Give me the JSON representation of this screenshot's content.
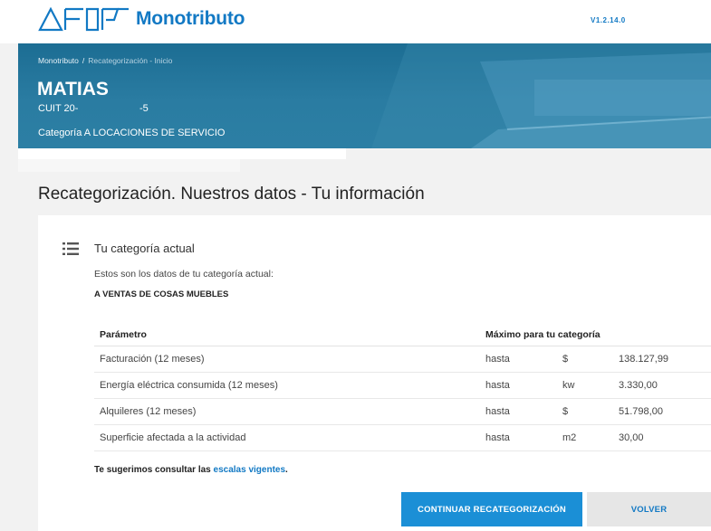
{
  "header": {
    "logo_text": "Monotributo",
    "logo_mark_label": "AFIP",
    "version": "V1.2.14.0"
  },
  "breadcrumb": {
    "items": [
      "Monotributo",
      "Recategorización - Inicio"
    ],
    "separator": "/"
  },
  "user": {
    "name": "MATIAS",
    "cuit_prefix": "CUIT 20-",
    "cuit_suffix": "-5",
    "categoria": "Categoría A LOCACIONES DE SERVICIO"
  },
  "page": {
    "title": "Recategorización. Nuestros datos - Tu información"
  },
  "section": {
    "icon": "list-icon",
    "title": "Tu categoría actual",
    "description": "Estos son los datos de tu categoría actual:",
    "current_category": "A VENTAS DE COSAS MUEBLES"
  },
  "table": {
    "headers": [
      "Parámetro",
      "Máximo para tu categoría"
    ],
    "rows": [
      {
        "param": "Facturación (12 meses)",
        "qualifier": "hasta",
        "unit": "$",
        "value": "138.127,99"
      },
      {
        "param": "Energía eléctrica consumida (12 meses)",
        "qualifier": "hasta",
        "unit": "kw",
        "value": "3.330,00"
      },
      {
        "param": "Alquileres (12 meses)",
        "qualifier": "hasta",
        "unit": "$",
        "value": "51.798,00"
      },
      {
        "param": "Superficie afectada a la actividad",
        "qualifier": "hasta",
        "unit": "m2",
        "value": "30,00"
      }
    ]
  },
  "suggestion": {
    "prefix": "Te sugerimos consultar las ",
    "link": "escalas vigentes",
    "suffix": "."
  },
  "buttons": {
    "continue": "CONTINUAR RECATEGORIZACIÓN",
    "back": "VOLVER"
  },
  "colors": {
    "brand_blue": "#1279c4",
    "hero_blue": "#2a7ca2",
    "primary_button": "#1b8fd6"
  }
}
